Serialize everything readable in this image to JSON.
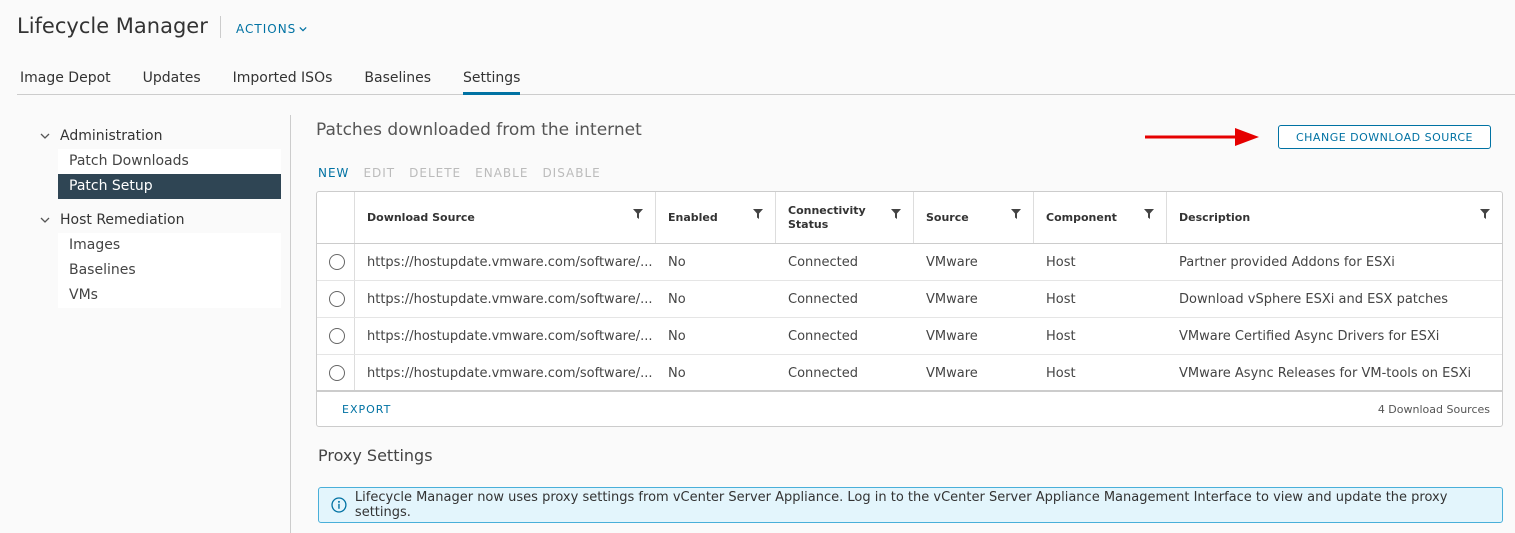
{
  "header": {
    "title": "Lifecycle Manager",
    "actions_label": "ACTIONS"
  },
  "tabs": [
    {
      "label": "Image Depot"
    },
    {
      "label": "Updates"
    },
    {
      "label": "Imported ISOs"
    },
    {
      "label": "Baselines"
    },
    {
      "label": "Settings",
      "active": true
    }
  ],
  "sidebar": {
    "groups": [
      {
        "label": "Administration",
        "items": [
          {
            "label": "Patch Downloads"
          },
          {
            "label": "Patch Setup",
            "selected": true
          }
        ]
      },
      {
        "label": "Host Remediation",
        "items": [
          {
            "label": "Images"
          },
          {
            "label": "Baselines"
          },
          {
            "label": "VMs"
          }
        ]
      }
    ]
  },
  "main": {
    "section_title": "Patches downloaded from the internet",
    "change_button": "CHANGE DOWNLOAD SOURCE",
    "toolbar": {
      "new": "NEW",
      "edit": "EDIT",
      "delete": "DELETE",
      "enable": "ENABLE",
      "disable": "DISABLE"
    },
    "grid": {
      "columns": [
        "Download Source",
        "Enabled",
        "Connectivity Status",
        "Source",
        "Component",
        "Description"
      ],
      "rows": [
        [
          "https://hostupdate.vmware.com/software/...",
          "No",
          "Connected",
          "VMware",
          "Host",
          "Partner provided Addons for ESXi"
        ],
        [
          "https://hostupdate.vmware.com/software/...",
          "No",
          "Connected",
          "VMware",
          "Host",
          "Download vSphere ESXi and ESX patches"
        ],
        [
          "https://hostupdate.vmware.com/software/...",
          "No",
          "Connected",
          "VMware",
          "Host",
          "VMware Certified Async Drivers for ESXi"
        ],
        [
          "https://hostupdate.vmware.com/software/...",
          "No",
          "Connected",
          "VMware",
          "Host",
          "VMware Async Releases for VM-tools on ESXi"
        ]
      ],
      "export_label": "EXPORT",
      "count_label": "4 Download Sources"
    },
    "proxy_title": "Proxy Settings",
    "proxy_alert": "Lifecycle Manager now uses proxy settings from vCenter Server Appliance. Log in to the vCenter Server Appliance Management Interface to view and update the proxy settings."
  },
  "colors": {
    "accent": "#0072a3",
    "selected_bg": "#2f4554",
    "annotation_arrow": "#e50000",
    "info_bg": "#e3f5fc"
  }
}
